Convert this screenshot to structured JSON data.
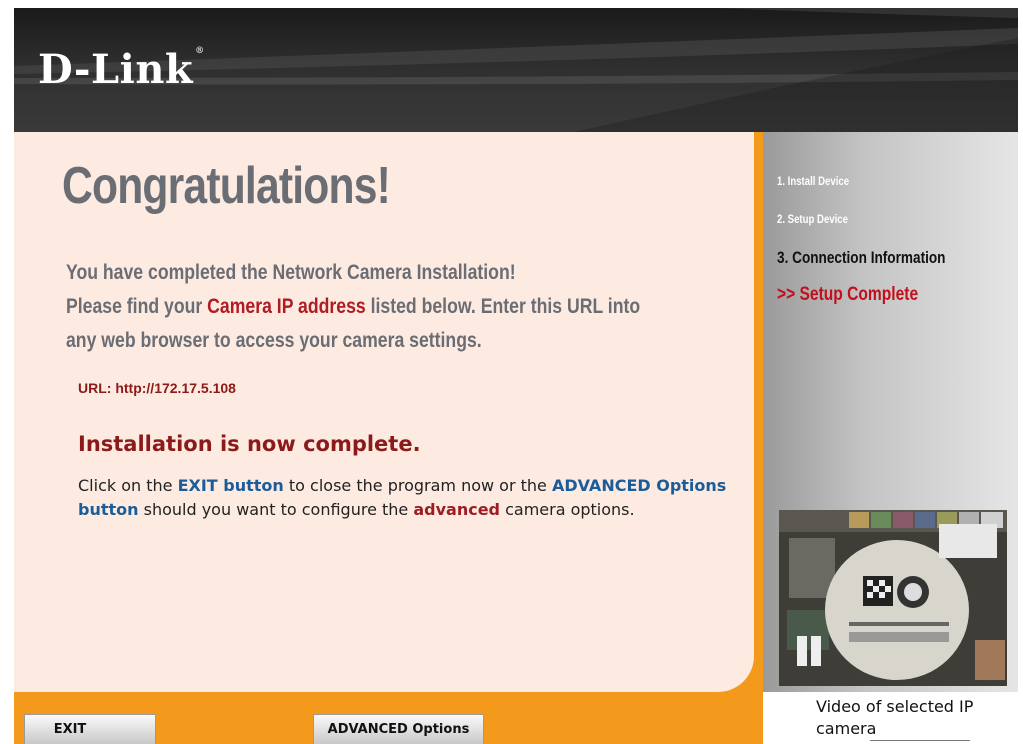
{
  "header": {
    "logo_text": "D-Link",
    "logo_mark": "®"
  },
  "main": {
    "title": "Congratulations!",
    "intro_line1": "You have completed the Network Camera Installation!",
    "intro_line2_pre": "Please find your ",
    "intro_line2_highlight": "Camera IP address",
    "intro_line2_post": " listed below. Enter this URL into",
    "intro_line3": "any web browser to access your camera settings.",
    "url_text": "URL: http://172.17.5.108",
    "complete_title": "Installation is now complete.",
    "instr_part1": "Click on the ",
    "instr_exit": "EXIT button",
    "instr_part2": " to close the program now or the ",
    "instr_advanced_btn": "ADVANCED Options button",
    "instr_part3": " should you want to configure the ",
    "instr_advanced": "advanced",
    "instr_part4": " camera options."
  },
  "sidebar": {
    "steps": [
      {
        "label": "1. Install Device"
      },
      {
        "label": "2. Setup Device"
      },
      {
        "label": "3. Connection Information"
      },
      {
        "label": ">> Setup Complete"
      }
    ],
    "video_caption": "Video of selected IP camera"
  },
  "buttons": {
    "exit_label": "EXIT",
    "advanced_label": "ADVANCED Options"
  },
  "colors": {
    "accent_orange": "#f39a1c",
    "content_bg": "#fdebe1",
    "title_gray": "#6b6d74",
    "highlight_red": "#b01c24",
    "link_blue": "#1a5d9a"
  }
}
